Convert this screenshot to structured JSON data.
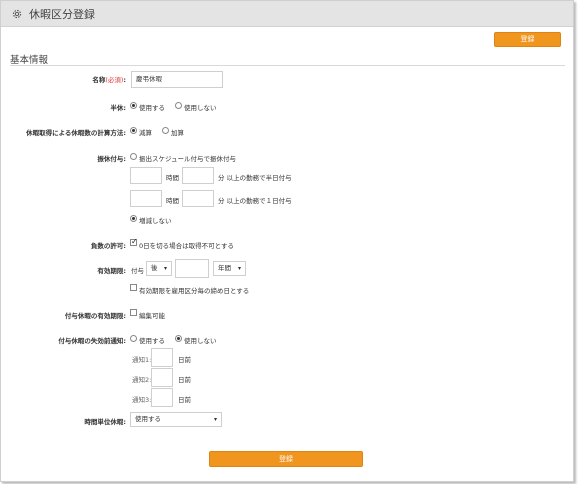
{
  "header": {
    "title": "休暇区分登録",
    "icon": "gear-icon"
  },
  "buttons": {
    "register_top": "登録",
    "register_bottom": "登録"
  },
  "section": {
    "title": "基本情報"
  },
  "fields": {
    "name": {
      "label": "名称",
      "required": "(必須)",
      "value": "慶弔休暇"
    },
    "half_day": {
      "label": "半休",
      "options": [
        "使用する",
        "使用しない"
      ],
      "selected": 0
    },
    "calc_method": {
      "label": "休暇取得による休暇数の計算方法",
      "options": [
        "減算",
        "加算"
      ],
      "selected": 0
    },
    "grant": {
      "label": "振休付与",
      "option1": "振出スケジュール付与で振休付与",
      "row1": {
        "hours_label": "時間",
        "minutes_suffix": "分 以上の勤務で半日付与"
      },
      "row2": {
        "hours_label": "時間",
        "minutes_suffix": "分 以上の勤務で１日付与"
      },
      "option2": "増減しない",
      "selected": 1
    },
    "negative": {
      "label": "負数の許可",
      "text": "0日を切る場合は取得不可とする",
      "checked": true
    },
    "validity": {
      "label": "有効期限",
      "prefix": "付与",
      "select1": "後",
      "select2": "年間",
      "checkbox_text": "有効期限を雇用区分毎の締め日とする",
      "checked": false
    },
    "granted_validity": {
      "label": "付与休暇の有効期限",
      "checkbox_text": "編集可能",
      "checked": false
    },
    "expiry_notice": {
      "label": "付与休暇の失効前通知",
      "options": [
        "使用する",
        "使用しない"
      ],
      "selected": 1,
      "notices": [
        {
          "label": "通知1:",
          "suffix": "日前"
        },
        {
          "label": "通知2:",
          "suffix": "日前"
        },
        {
          "label": "通知3:",
          "suffix": "日前"
        }
      ]
    },
    "hourly_leave": {
      "label": "時間単位休暇",
      "value": "使用する"
    }
  }
}
